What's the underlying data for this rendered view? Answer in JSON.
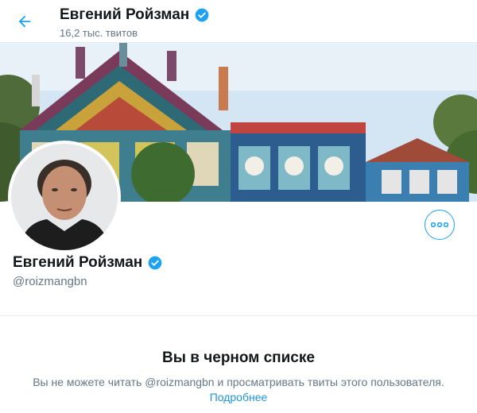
{
  "header": {
    "name": "Евгений Ройзман",
    "tweets_count": "16,2 тыс. твитов"
  },
  "profile": {
    "name": "Евгений Ройзман",
    "handle": "@roizmangbn"
  },
  "blocked": {
    "title": "Вы в черном списке",
    "message": "Вы не можете читать @roizmangbn и просматривать твиты этого пользователя.",
    "link": "Подробнее"
  },
  "colors": {
    "accent": "#1da1f2",
    "secondary_text": "#657786",
    "verified": "#1da1f2"
  },
  "icons": {
    "back": "back-arrow-icon",
    "verified": "verified-badge-icon",
    "more": "more-dots-icon"
  }
}
